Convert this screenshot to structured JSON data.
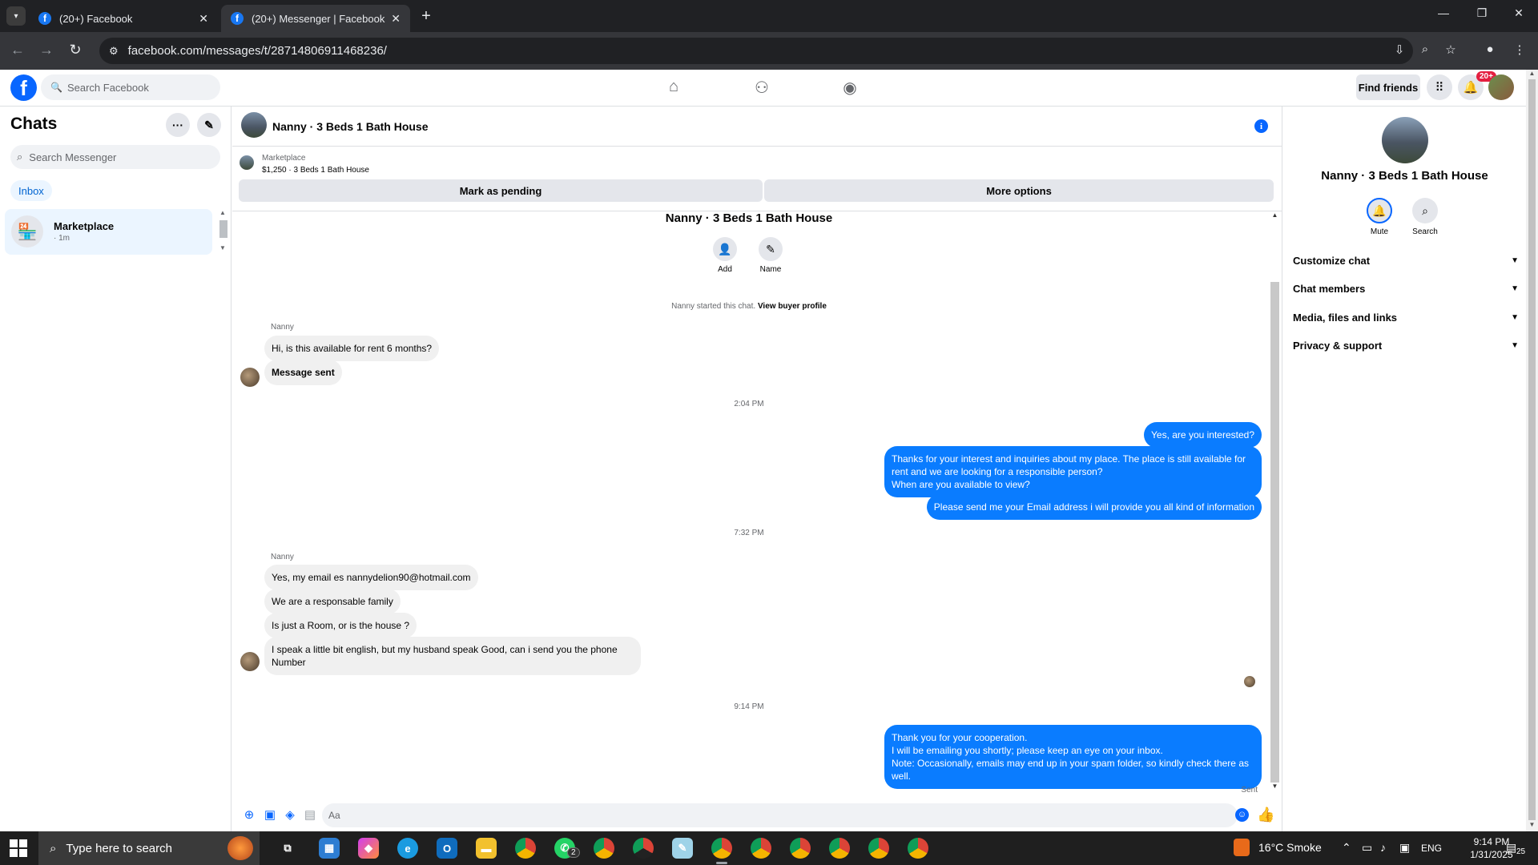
{
  "browser": {
    "tabs": [
      {
        "title": "(20+) Facebook",
        "active": false
      },
      {
        "title": "(20+) Messenger | Facebook",
        "active": true
      }
    ],
    "url": "facebook.com/messages/t/28714806911468236/"
  },
  "fb_header": {
    "logo": "f",
    "search_placeholder": "Search Facebook",
    "find_friends_label": "Find friends",
    "notification_count": "20+",
    "nav_icons": [
      "home-icon",
      "friends-icon",
      "groups-icon"
    ]
  },
  "left_panel": {
    "title": "Chats",
    "search_placeholder": "Search Messenger",
    "filter_chip": "Inbox",
    "chats": [
      {
        "name": "Marketplace",
        "time": "· 1m",
        "icon": "store-icon"
      }
    ]
  },
  "conversation": {
    "title": "Nanny · 3 Beds 1 Bath House",
    "marketplace_label": "Marketplace",
    "listing": "$1,250 · 3 Beds 1 Bath House",
    "mark_pending_label": "Mark as pending",
    "more_options_label": "More options",
    "intro_name": "Nanny · 3 Beds 1 Bath House",
    "actions": [
      {
        "label": "Add",
        "icon": "add-person-icon"
      },
      {
        "label": "Name",
        "icon": "pencil-icon"
      }
    ],
    "started_text": "Nanny started this chat.",
    "view_profile_label": "View buyer profile",
    "sender_name": "Nanny",
    "messages_group1": [
      "Hi, is this available for rent 6 months?",
      "Message sent"
    ],
    "time1": "2:04 PM",
    "outgoing1": [
      "Yes, are you interested?",
      "Thanks for your interest and inquiries about my place. The place is still available for rent and we are looking for a responsible person?\nWhen are you available to view?",
      "Please send me your Email address i will provide you all kind of information"
    ],
    "time2": "7:32 PM",
    "messages_group2": [
      "Yes, my email es nannydelion90@hotmail.com",
      "We are a responsable family",
      "Is just a Room, or is the house ?",
      "I speak a little bit english, but my husband speak Good, can i send you the phone Number"
    ],
    "time3": "9:14 PM",
    "outgoing2": "Thank you for your cooperation.\nI will be emailing you shortly; please keep an eye on your inbox.\nNote: Occasionally, emails may end up in your spam folder, so kindly check there as well.",
    "sent_status": "Sent",
    "composer_placeholder": "Aa"
  },
  "right_panel": {
    "name": "Nanny · 3 Beds 1 Bath House",
    "actions": [
      {
        "label": "Mute",
        "icon": "bell-icon"
      },
      {
        "label": "Search",
        "icon": "search-icon"
      }
    ],
    "sections": [
      "Customize chat",
      "Chat members",
      "Media, files and links",
      "Privacy & support"
    ]
  },
  "taskbar": {
    "search_placeholder": "Type here to search",
    "whatsapp_badge": "2",
    "weather": "16°C  Smoke",
    "language": "ENG",
    "time": "9:14 PM",
    "date": "1/31/2025",
    "notification_count": "25"
  }
}
